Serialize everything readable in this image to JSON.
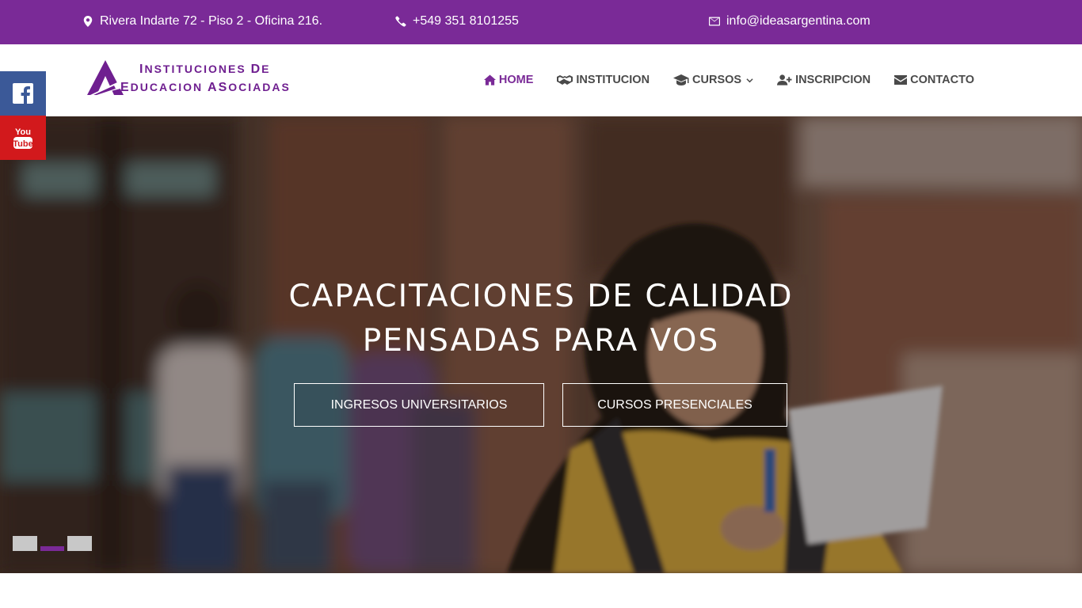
{
  "topbar": {
    "address": "Rivera Indarte 72 - Piso 2 - Oficina 216.",
    "phone": "+549 351 8101255",
    "email": "info@ideasargentina.com",
    "background": "#7a2a97"
  },
  "logo": {
    "line1_first": "I",
    "line1_rest": "NSTITUCIONES ",
    "line1_cap2": "D",
    "line1_rest2": "E",
    "line2_first": "E",
    "line2_rest": "DUCACION ",
    "line2_caps": "AS",
    "line2_rest2": "OCIADAS",
    "brand_color": "#6f1f90"
  },
  "nav": {
    "items": [
      {
        "label": "HOME",
        "icon": "home-icon",
        "active": true
      },
      {
        "label": "INSTITUCION",
        "icon": "handshake-icon"
      },
      {
        "label": "CURSOS",
        "icon": "graduation-cap-icon",
        "dropdown": true
      },
      {
        "label": "INSCRIPCION",
        "icon": "user-plus-icon"
      },
      {
        "label": "CONTACTO",
        "icon": "envelope-icon"
      }
    ]
  },
  "social": {
    "facebook": "facebook-icon",
    "youtube": "youtube-icon",
    "youtube_text_1": "You",
    "youtube_text_2": "Tube"
  },
  "hero": {
    "title_line1": "CAPACITACIONES DE CALIDAD",
    "title_line2": "PENSADAS PARA VOS",
    "button1": "INGRESOS UNIVERSITARIOS",
    "button2": "CURSOS PRESENCIALES",
    "slides": 3,
    "active_slide": 2
  }
}
